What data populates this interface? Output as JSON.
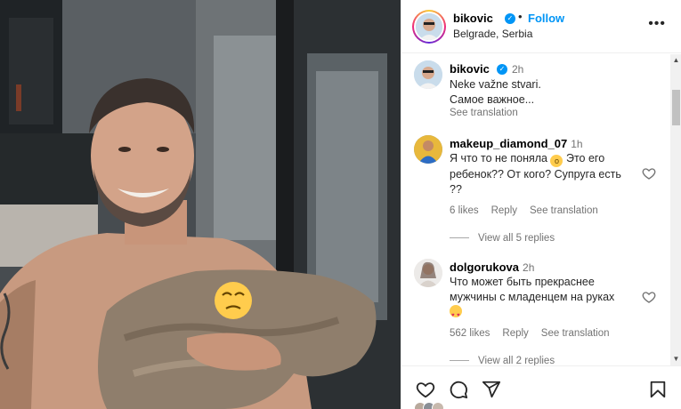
{
  "post": {
    "username": "bikovic",
    "location": "Belgrade, Serbia",
    "follow_label": "Follow",
    "separator": "•",
    "more_label": "•••"
  },
  "caption": {
    "username": "bikovic",
    "time": "2h",
    "lines": [
      "Neke važne stvari.",
      "Самое важное..."
    ],
    "see_translation": "See translation"
  },
  "comments": [
    {
      "username": "makeup_diamond_07",
      "time": "1h",
      "lines": [
        "Я что то не поняла",
        "ребенок?? От кого? Супруга есть",
        "??"
      ],
      "inline_tail": "Это его",
      "likes": "6 likes",
      "reply": "Reply",
      "see_translation": "See translation",
      "view_replies": "View all 5 replies"
    },
    {
      "username": "dolgorukova",
      "time": "2h",
      "lines": [
        "Что может быть прекраснее",
        "мужчины с младенцем на руках"
      ],
      "likes": "562 likes",
      "reply": "Reply",
      "see_translation": "See translation",
      "view_replies": "View all 2 replies"
    }
  ],
  "icons": {
    "verified": "verified-badge-icon",
    "heart": "heart-icon",
    "comment": "comment-icon",
    "share": "share-icon",
    "save": "bookmark-icon",
    "more": "more-icon"
  },
  "colors": {
    "accent": "#0095f6",
    "text": "#262626",
    "muted": "#737373"
  }
}
